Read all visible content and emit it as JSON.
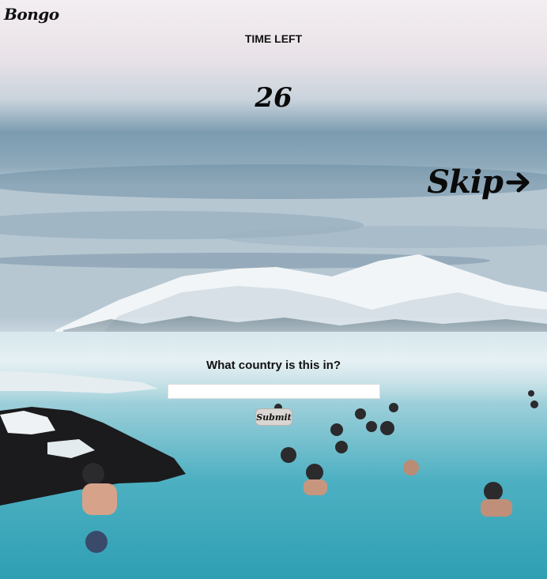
{
  "app": {
    "logo": "Bongo"
  },
  "timer": {
    "label": "TIME LEFT",
    "value": "26"
  },
  "skip": {
    "label": "Skip",
    "icon": "arrow-right-icon"
  },
  "quiz": {
    "question": "What country is this in?",
    "answer_value": "",
    "answer_placeholder": "",
    "submit_label": "Submit"
  },
  "background": {
    "scene": "photo"
  }
}
